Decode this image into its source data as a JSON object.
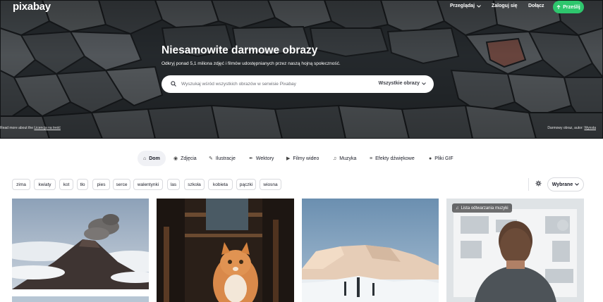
{
  "header": {
    "logo": "pixabay",
    "nav": {
      "browse": "Przeglądaj",
      "login": "Zaloguj się",
      "join": "Dołącz",
      "upload": "Prześlij"
    }
  },
  "hero": {
    "title": "Niesamowite darmowe obrazy",
    "subtitle": "Odkryj ponad 5,1 miliona zdjęć i filmów udostępnianych przez naszą hojną społeczność.",
    "search_placeholder": "Wyszukaj wśród wszystkich obrazów w serwisie Pixabay",
    "search_category": "Wszystkie obrazy",
    "license_prefix": "Read more about the",
    "license_link": "Licencja na treść",
    "credit_prefix": "Darmowy obraz, autor:",
    "credit_author": "Wynsta"
  },
  "tabs": [
    {
      "label": "Dom",
      "icon": "home-icon"
    },
    {
      "label": "Zdjęcia",
      "icon": "camera-icon"
    },
    {
      "label": "Ilustracje",
      "icon": "brush-icon"
    },
    {
      "label": "Wektory",
      "icon": "pen-nib-icon"
    },
    {
      "label": "Filmy wideo",
      "icon": "video-icon"
    },
    {
      "label": "Muzyka",
      "icon": "music-note-icon"
    },
    {
      "label": "Efekty dźwiękowe",
      "icon": "waveform-icon"
    },
    {
      "label": "Pliki GIF",
      "icon": "gif-icon"
    }
  ],
  "tags": [
    "zima",
    "kwiaty",
    "kot",
    "tło",
    "pies",
    "serce",
    "walentynki",
    "las",
    "szkoła",
    "kobieta",
    "pączki",
    "wiosna"
  ],
  "sort": {
    "label": "Wybrane"
  },
  "gallery": {
    "music_badge": "Lista odtwarzania muzyki"
  },
  "colors": {
    "accent_green": "#2ec66d",
    "hero_dark": "#30363a"
  }
}
